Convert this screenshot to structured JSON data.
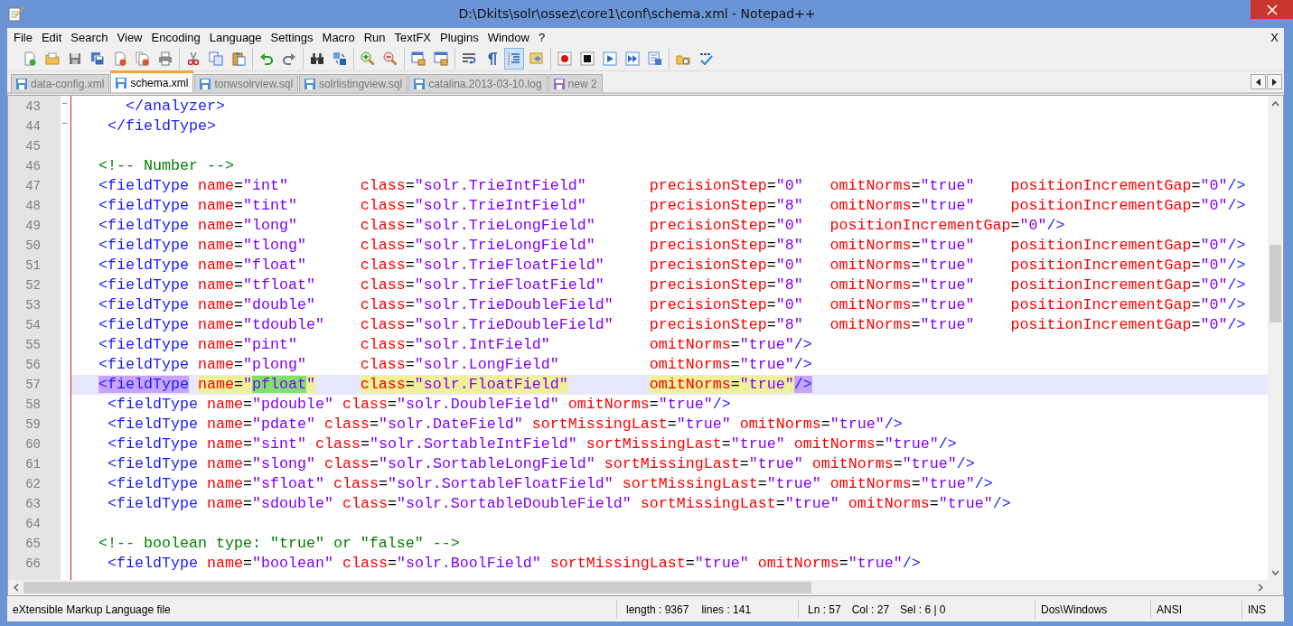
{
  "window": {
    "title": "D:\\Dkits\\solr\\ossez\\core1\\conf\\schema.xml - Notepad++"
  },
  "menu": {
    "items": [
      "File",
      "Edit",
      "Search",
      "View",
      "Encoding",
      "Language",
      "Settings",
      "Macro",
      "Run",
      "TextFX",
      "Plugins",
      "Window",
      "?"
    ],
    "close_label": "X"
  },
  "toolbar": {
    "groups": [
      {
        "buttons": [
          {
            "kind": "new",
            "pressed": false
          },
          {
            "kind": "open",
            "pressed": false
          },
          {
            "kind": "save",
            "pressed": false
          },
          {
            "kind": "save-all",
            "pressed": false
          },
          {
            "kind": "close",
            "pressed": false
          },
          {
            "kind": "close-all",
            "pressed": false
          },
          {
            "kind": "print",
            "pressed": false
          }
        ]
      },
      {
        "buttons": [
          {
            "kind": "cut",
            "pressed": false
          },
          {
            "kind": "copy",
            "pressed": false
          },
          {
            "kind": "paste",
            "pressed": false
          }
        ]
      },
      {
        "buttons": [
          {
            "kind": "undo",
            "pressed": false
          },
          {
            "kind": "redo",
            "pressed": false
          }
        ]
      },
      {
        "buttons": [
          {
            "kind": "find",
            "pressed": false
          },
          {
            "kind": "replace",
            "pressed": false
          }
        ]
      },
      {
        "buttons": [
          {
            "kind": "zoom-in",
            "pressed": false
          },
          {
            "kind": "zoom-out",
            "pressed": false
          }
        ]
      },
      {
        "buttons": [
          {
            "kind": "sync-v",
            "pressed": false
          },
          {
            "kind": "sync-h",
            "pressed": false
          }
        ]
      },
      {
        "buttons": [
          {
            "kind": "wrap",
            "pressed": false
          },
          {
            "kind": "pilcrow",
            "pressed": false
          },
          {
            "kind": "indent",
            "pressed": true
          },
          {
            "kind": "panel",
            "pressed": false
          }
        ]
      },
      {
        "buttons": [
          {
            "kind": "record",
            "pressed": false
          },
          {
            "kind": "stop",
            "pressed": false
          },
          {
            "kind": "play",
            "pressed": false
          },
          {
            "kind": "play-multi",
            "pressed": false
          },
          {
            "kind": "save-macro",
            "pressed": false
          }
        ]
      },
      {
        "buttons": [
          {
            "kind": "launch",
            "pressed": false
          },
          {
            "kind": "spell",
            "pressed": false
          }
        ]
      }
    ]
  },
  "tabs": [
    {
      "label": "data-config.xml",
      "selected": false,
      "color": "#4a90d9"
    },
    {
      "label": "schema.xml",
      "selected": true,
      "color": "#4a90d9"
    },
    {
      "label": "tonwsolrview.sql",
      "selected": false,
      "color": "#4a90d9"
    },
    {
      "label": "solrlistingview.sql",
      "selected": false,
      "color": "#4a90d9"
    },
    {
      "label": "catalina.2013-03-10.log",
      "selected": false,
      "color": "#4a90d9"
    },
    {
      "label": "new 2",
      "selected": false,
      "color": "#9a6fc0"
    }
  ],
  "editor": {
    "lines": [
      {
        "number": "43",
        "selected": false,
        "kind": "plain",
        "segments": [
          {
            "text": "      </analyzer>"
          }
        ]
      },
      {
        "number": "44",
        "selected": false,
        "kind": "plain",
        "segments": [
          {
            "text": "    </fieldType>"
          }
        ]
      },
      {
        "number": "45",
        "selected": false,
        "kind": "plain"
      },
      {
        "number": "46",
        "selected": false,
        "kind": "plain",
        "segments": [
          {
            "text": "   <!-- Number -->"
          }
        ]
      },
      {
        "number": "47",
        "selected": false,
        "kind": "columns",
        "segments": [
          {
            "text": "<fieldType name=\"int\""
          },
          {
            "text": "class=\"solr.TrieIntField\""
          },
          {
            "text": "precisionStep=\"0\""
          },
          {
            "text": "omitNorms=\"true\""
          },
          {
            "text": "positionIncrementGap=\"0\"/>"
          }
        ]
      },
      {
        "number": "48",
        "selected": false,
        "kind": "columns",
        "segments": [
          {
            "text": "<fieldType name=\"tint\""
          },
          {
            "text": "class=\"solr.TrieIntField\""
          },
          {
            "text": "precisionStep=\"8\""
          },
          {
            "text": "omitNorms=\"true\""
          },
          {
            "text": "positionIncrementGap=\"0\"/>"
          }
        ]
      },
      {
        "number": "49",
        "selected": false,
        "kind": "columns",
        "segments": [
          {
            "text": "<fieldType name=\"long\""
          },
          {
            "text": "class=\"solr.TrieLongField\""
          },
          {
            "text": "precisionStep=\"0\""
          },
          {
            "text": "positionIncrementGap=\"0\"/>"
          }
        ]
      },
      {
        "number": "50",
        "selected": false,
        "kind": "columns",
        "segments": [
          {
            "text": "<fieldType name=\"tlong\""
          },
          {
            "text": "class=\"solr.TrieLongField\""
          },
          {
            "text": "precisionStep=\"8\""
          },
          {
            "text": "omitNorms=\"true\""
          },
          {
            "text": "positionIncrementGap=\"0\"/>"
          }
        ]
      },
      {
        "number": "51",
        "selected": false,
        "kind": "columns",
        "segments": [
          {
            "text": "<fieldType name=\"float\""
          },
          {
            "text": "class=\"solr.TrieFloatField\""
          },
          {
            "text": "precisionStep=\"0\""
          },
          {
            "text": "omitNorms=\"true\""
          },
          {
            "text": "positionIncrementGap=\"0\"/>"
          }
        ]
      },
      {
        "number": "52",
        "selected": false,
        "kind": "columns",
        "segments": [
          {
            "text": "<fieldType name=\"tfloat\""
          },
          {
            "text": "class=\"solr.TrieFloatField\""
          },
          {
            "text": "precisionStep=\"8\""
          },
          {
            "text": "omitNorms=\"true\""
          },
          {
            "text": "positionIncrementGap=\"0\"/>"
          }
        ]
      },
      {
        "number": "53",
        "selected": false,
        "kind": "columns",
        "segments": [
          {
            "text": "<fieldType name=\"double\""
          },
          {
            "text": "class=\"solr.TrieDoubleField\""
          },
          {
            "text": "precisionStep=\"0\""
          },
          {
            "text": "omitNorms=\"true\""
          },
          {
            "text": "positionIncrementGap=\"0\"/>"
          }
        ]
      },
      {
        "number": "54",
        "selected": false,
        "kind": "columns",
        "segments": [
          {
            "text": "<fieldType name=\"tdouble\""
          },
          {
            "text": "class=\"solr.TrieDoubleField\""
          },
          {
            "text": "precisionStep=\"8\""
          },
          {
            "text": "omitNorms=\"true\""
          },
          {
            "text": "positionIncrementGap=\"0\"/>"
          }
        ]
      },
      {
        "number": "55",
        "selected": false,
        "kind": "columns",
        "segments": [
          {
            "text": "<fieldType name=\"pint\""
          },
          {
            "text": "class=\"solr.IntField\""
          },
          {
            "text": "omitNorms=\"true\"/>"
          }
        ]
      },
      {
        "number": "56",
        "selected": false,
        "kind": "columns",
        "segments": [
          {
            "text": "<fieldType name=\"plong\""
          },
          {
            "text": "class=\"solr.LongField\""
          },
          {
            "text": "omitNorms=\"true\"/>"
          }
        ]
      },
      {
        "number": "57",
        "selected": true,
        "kind": "columns",
        "segments": [
          {
            "parts": [
              {
                "text": "<fieldType",
                "kind": "brace"
              },
              {
                "text": " name=\"",
                "kind": "smart"
              },
              {
                "text": "pfloat",
                "kind": "found"
              },
              {
                "text": "\"",
                "kind": "smart"
              }
            ]
          },
          {
            "parts": [
              {
                "text": "class=\"solr.FloatField\"",
                "kind": "smart"
              }
            ]
          },
          {
            "parts": [
              {
                "text": "omitNorms=\"true\"",
                "kind": "smart"
              },
              {
                "text": "/>",
                "kind": "brace"
              }
            ]
          }
        ]
      },
      {
        "number": "58",
        "selected": false,
        "kind": "plain",
        "segments": [
          {
            "text": "    <fieldType name=\"pdouble\" class=\"solr.DoubleField\" omitNorms=\"true\"/>"
          }
        ]
      },
      {
        "number": "59",
        "selected": false,
        "kind": "plain",
        "segments": [
          {
            "text": "    <fieldType name=\"pdate\" class=\"solr.DateField\" sortMissingLast=\"true\" omitNorms=\"true\"/>"
          }
        ]
      },
      {
        "number": "60",
        "selected": false,
        "kind": "plain",
        "segments": [
          {
            "text": "    <fieldType name=\"sint\" class=\"solr.SortableIntField\" sortMissingLast=\"true\" omitNorms=\"true\"/>"
          }
        ]
      },
      {
        "number": "61",
        "selected": false,
        "kind": "plain",
        "segments": [
          {
            "text": "    <fieldType name=\"slong\" class=\"solr.SortableLongField\" sortMissingLast=\"true\" omitNorms=\"true\"/>"
          }
        ]
      },
      {
        "number": "62",
        "selected": false,
        "kind": "plain",
        "segments": [
          {
            "text": "    <fieldType name=\"sfloat\" class=\"solr.SortableFloatField\" sortMissingLast=\"true\" omitNorms=\"true\"/>"
          }
        ]
      },
      {
        "number": "63",
        "selected": false,
        "kind": "plain",
        "segments": [
          {
            "text": "    <fieldType name=\"sdouble\" class=\"solr.SortableDoubleField\" sortMissingLast=\"true\" omitNorms=\"true\"/>"
          }
        ]
      },
      {
        "number": "64",
        "selected": false,
        "kind": "plain"
      },
      {
        "number": "65",
        "selected": false,
        "kind": "plain",
        "segments": [
          {
            "text": "   <!-- boolean type: \"true\" or \"false\" -->"
          }
        ]
      },
      {
        "number": "66",
        "selected": false,
        "kind": "plain",
        "segments": [
          {
            "text": "    <fieldType name=\"boolean\" class=\"solr.BoolField\" sortMissingLast=\"true\" omitNorms=\"true\"/>"
          }
        ]
      }
    ]
  },
  "status_bar": {
    "file_type": "eXtensible Markup Language file",
    "length": "length : 9367",
    "lines": "lines : 141",
    "ln": "Ln : 57",
    "col": "Col : 27",
    "sel": "Sel : 6 | 0",
    "eol": "Dos\\Windows",
    "encoding": "ANSI",
    "mode": "INS"
  }
}
